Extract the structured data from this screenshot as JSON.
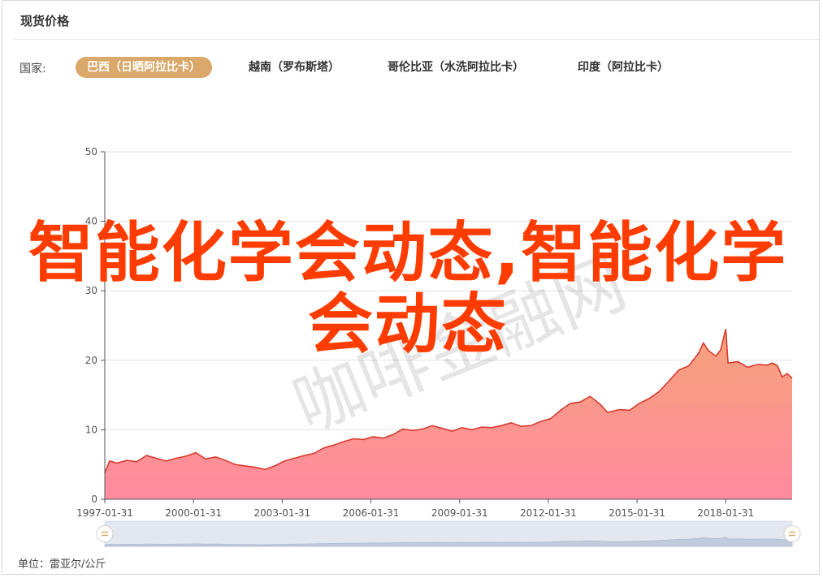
{
  "panel": {
    "title": "现货价格"
  },
  "filter": {
    "label": "国家:",
    "tabs": [
      {
        "label": "巴西（日晒阿拉比卡）",
        "active": true
      },
      {
        "label": "越南（罗布斯塔）",
        "active": false
      },
      {
        "label": "哥伦比亚（水洗阿拉比卡）",
        "active": false
      },
      {
        "label": "印度（阿拉比卡）",
        "active": false
      }
    ]
  },
  "unit_text": "单位：雷亚尔/公斤",
  "overlay_text": "智能化学会动态,智能化学会动态",
  "watermark_text": "咖啡金融网",
  "colors": {
    "line": "#d63a2f",
    "area_top": "#f6a27a",
    "area_bottom": "#ff8aa0",
    "tab_active": "#d9a86a",
    "overlay": "#ff3c00"
  },
  "chart_data": {
    "type": "area",
    "ylim": [
      0,
      50
    ],
    "yticks": [
      0,
      10,
      20,
      30,
      40,
      50
    ],
    "xticks": [
      "1997-01-31",
      "2000-01-31",
      "2003-01-31",
      "2006-01-31",
      "2009-01-31",
      "2012-01-31",
      "2015-01-31",
      "2018-01-31"
    ],
    "xlim": [
      "1997-01-31",
      "2020-04-30"
    ],
    "series": [
      {
        "points": [
          [
            "1997-01-31",
            3.8
          ],
          [
            "1997-03-31",
            5.5
          ],
          [
            "1997-06-30",
            5.2
          ],
          [
            "1997-10-31",
            5.6
          ],
          [
            "1998-02-28",
            5.4
          ],
          [
            "1998-06-30",
            6.3
          ],
          [
            "1998-10-31",
            5.9
          ],
          [
            "1999-02-28",
            5.5
          ],
          [
            "1999-06-30",
            5.9
          ],
          [
            "1999-10-31",
            6.2
          ],
          [
            "2000-02-29",
            6.7
          ],
          [
            "2000-06-30",
            5.8
          ],
          [
            "2000-10-31",
            6.1
          ],
          [
            "2001-02-28",
            5.6
          ],
          [
            "2001-06-30",
            5.0
          ],
          [
            "2001-10-31",
            4.8
          ],
          [
            "2002-02-28",
            4.6
          ],
          [
            "2002-06-30",
            4.3
          ],
          [
            "2002-10-31",
            4.8
          ],
          [
            "2003-02-28",
            5.5
          ],
          [
            "2003-06-30",
            5.9
          ],
          [
            "2003-10-31",
            6.3
          ],
          [
            "2004-02-29",
            6.6
          ],
          [
            "2004-06-30",
            7.4
          ],
          [
            "2004-10-31",
            7.8
          ],
          [
            "2005-02-28",
            8.3
          ],
          [
            "2005-06-30",
            8.7
          ],
          [
            "2005-10-31",
            8.6
          ],
          [
            "2006-02-28",
            9.0
          ],
          [
            "2006-06-30",
            8.8
          ],
          [
            "2006-10-31",
            9.3
          ],
          [
            "2007-02-28",
            10.1
          ],
          [
            "2007-06-30",
            9.9
          ],
          [
            "2007-10-31",
            10.1
          ],
          [
            "2008-02-29",
            10.6
          ],
          [
            "2008-06-30",
            10.2
          ],
          [
            "2008-10-31",
            9.8
          ],
          [
            "2009-02-28",
            10.3
          ],
          [
            "2009-06-30",
            10.0
          ],
          [
            "2009-10-31",
            10.4
          ],
          [
            "2010-02-28",
            10.3
          ],
          [
            "2010-06-30",
            10.6
          ],
          [
            "2010-10-31",
            11.0
          ],
          [
            "2011-02-28",
            10.5
          ],
          [
            "2011-06-30",
            10.6
          ],
          [
            "2011-10-31",
            11.2
          ],
          [
            "2012-02-29",
            11.6
          ],
          [
            "2012-06-30",
            12.8
          ],
          [
            "2012-10-31",
            13.8
          ],
          [
            "2013-02-28",
            14.0
          ],
          [
            "2013-06-30",
            14.8
          ],
          [
            "2013-10-31",
            13.7
          ],
          [
            "2014-01-31",
            12.5
          ],
          [
            "2014-06-30",
            12.9
          ],
          [
            "2014-10-31",
            12.8
          ],
          [
            "2015-02-28",
            13.8
          ],
          [
            "2015-06-30",
            14.5
          ],
          [
            "2015-10-31",
            15.5
          ],
          [
            "2016-02-29",
            17.0
          ],
          [
            "2016-06-30",
            18.6
          ],
          [
            "2016-10-31",
            19.2
          ],
          [
            "2017-02-28",
            21.0
          ],
          [
            "2017-04-30",
            22.5
          ],
          [
            "2017-06-30",
            21.4
          ],
          [
            "2017-09-30",
            20.6
          ],
          [
            "2017-11-30",
            21.5
          ],
          [
            "2018-01-31",
            24.5
          ],
          [
            "2018-02-28",
            19.6
          ],
          [
            "2018-06-30",
            19.8
          ],
          [
            "2018-10-31",
            19.0
          ],
          [
            "2019-02-28",
            19.4
          ],
          [
            "2019-06-30",
            19.3
          ],
          [
            "2019-08-31",
            19.6
          ],
          [
            "2019-10-31",
            19.2
          ],
          [
            "2019-12-31",
            17.6
          ],
          [
            "2020-02-29",
            18.1
          ],
          [
            "2020-04-30",
            17.4
          ]
        ]
      }
    ],
    "grid": true,
    "zoom_slider": {
      "start": 0,
      "end": 1
    }
  }
}
